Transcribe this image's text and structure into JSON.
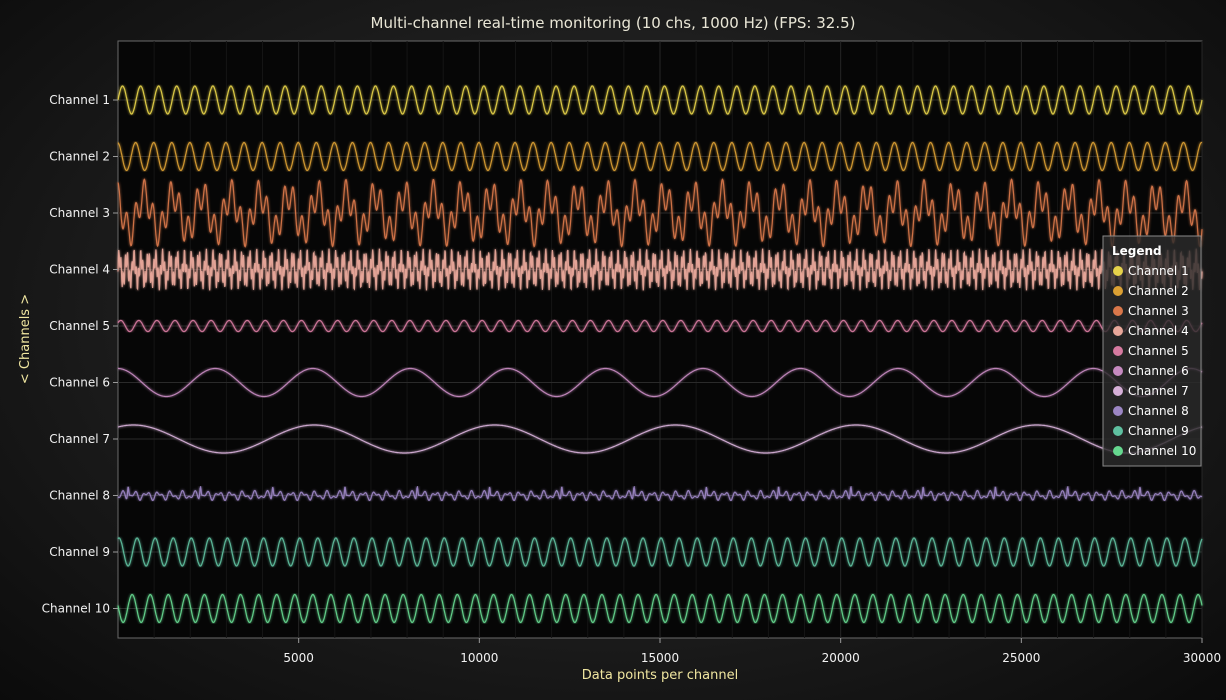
{
  "chart_data": {
    "type": "line",
    "title": "Multi-channel real-time monitoring (10 chs, 1000 Hz) (FPS: 32.5)",
    "xlabel": "Data points per channel",
    "ylabel": "< Channels >",
    "xlim": [
      0,
      30000
    ],
    "x_ticks": [
      5000,
      10000,
      15000,
      20000,
      25000,
      30000
    ],
    "x_tick_labels": [
      "5000",
      "10000",
      "15000",
      "20000",
      "25000",
      "30000"
    ],
    "grid": true,
    "legend_title": "Legend",
    "legend_position": "right",
    "series": [
      {
        "name": "Channel 1",
        "color": "#e6d24a",
        "waveform": "sine",
        "period": 500,
        "amplitude": 0.5
      },
      {
        "name": "Channel 2",
        "color": "#dba033",
        "waveform": "sine",
        "period": 500,
        "amplitude": 0.5
      },
      {
        "name": "Channel 3",
        "color": "#d9774a",
        "waveform": "mixed",
        "period": 800,
        "amplitude": 1.2
      },
      {
        "name": "Channel 4",
        "color": "#e8a79a",
        "waveform": "mixed",
        "period": 200,
        "amplitude": 0.75
      },
      {
        "name": "Channel 5",
        "color": "#d67aa0",
        "waveform": "sine",
        "period": 500,
        "amplitude": 0.2
      },
      {
        "name": "Channel 6",
        "color": "#c68ac0",
        "waveform": "sine",
        "period": 2700,
        "amplitude": 0.5
      },
      {
        "name": "Channel 7",
        "color": "#d6b0d8",
        "waveform": "sine",
        "period": 5000,
        "amplitude": 0.5
      },
      {
        "name": "Channel 8",
        "color": "#9c86c4",
        "waveform": "ecg",
        "period": 2000,
        "amplitude": 0.3
      },
      {
        "name": "Channel 9",
        "color": "#5fc0a0",
        "waveform": "sine",
        "period": 500,
        "amplitude": 0.5
      },
      {
        "name": "Channel 10",
        "color": "#66d88f",
        "waveform": "sine",
        "period": 500,
        "amplitude": 0.5
      }
    ]
  }
}
